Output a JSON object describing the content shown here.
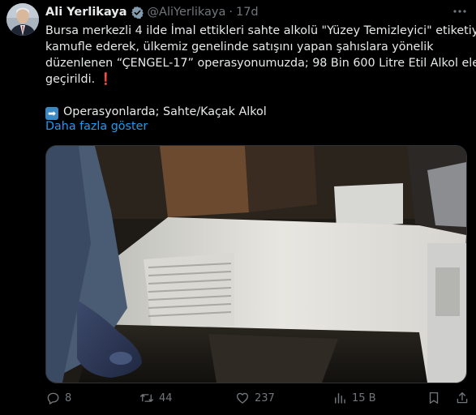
{
  "author": {
    "name": "Ali Yerlikaya",
    "handle": "@AliYerlikaya",
    "time": "17d"
  },
  "tweet": {
    "lines": [
      "Bursa merkezli 4 ilde İmal ettikleri sahte alkolü \"Yüzey Temizleyici\" etiketiyle",
      "kamufle ederek, ülkemiz genelinde satışını yapan şahıslara yönelik",
      "düzenlenen “ÇENGEL-17” operasyonumuzda; 98 Bin 600 Litre Etil Alkol ele",
      "geçirildi."
    ],
    "exclamation": "❗",
    "arrow_emoji": "➡",
    "link_line": "Operasyonlarda; Sahte/Kaçak Alkol",
    "show_more": "Daha fazla göster"
  },
  "actions": {
    "replies": "8",
    "reposts": "44",
    "likes": "237",
    "views": "15 B"
  },
  "icons": [
    "verified-badge-icon",
    "more-icon",
    "reply-icon",
    "repost-icon",
    "like-icon",
    "views-icon",
    "bookmark-icon",
    "share-icon"
  ],
  "colors": {
    "background": "#000000",
    "text": "#e7e9ea",
    "muted": "#71767b",
    "link": "#1d9bf0",
    "verified": "#829aab"
  }
}
